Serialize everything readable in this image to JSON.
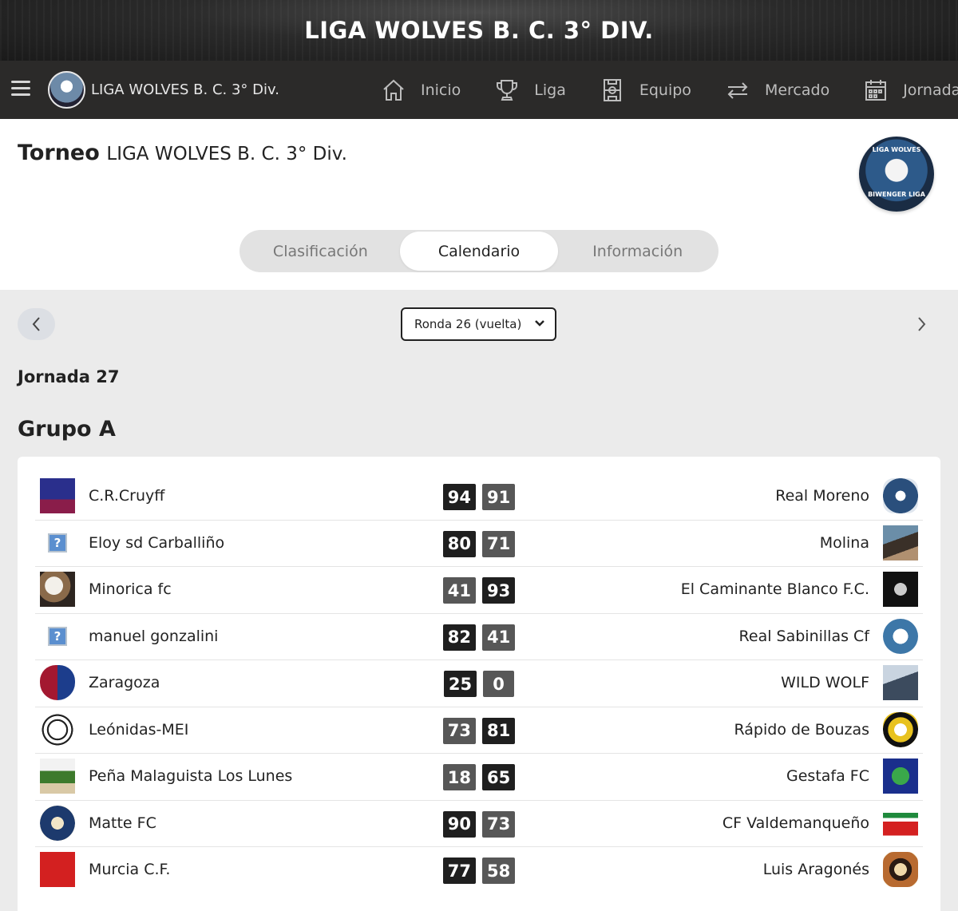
{
  "banner": {
    "title": "LIGA WOLVES B. C. 3° DIV."
  },
  "nav": {
    "league_name": "LIGA WOLVES B. C. 3° Div.",
    "items": [
      {
        "label": "Inicio",
        "icon": "home-icon"
      },
      {
        "label": "Liga",
        "icon": "trophy-icon"
      },
      {
        "label": "Equipo",
        "icon": "field-icon"
      },
      {
        "label": "Mercado",
        "icon": "transfer-icon"
      },
      {
        "label": "Jornada",
        "icon": "calendar-icon"
      }
    ]
  },
  "header": {
    "torneo_label": "Torneo",
    "torneo_name": "LIGA WOLVES B. C. 3° Div.",
    "badge_top": "LIGA WOLVES",
    "badge_bottom": "BIWENGER LIGA"
  },
  "tabs": [
    {
      "label": "Clasificación",
      "active": false
    },
    {
      "label": "Calendario",
      "active": true
    },
    {
      "label": "Información",
      "active": false
    }
  ],
  "round_selector": {
    "value": "Ronda 26 (vuelta)"
  },
  "jornada": {
    "title": "Jornada 27"
  },
  "group": {
    "title": "Grupo A"
  },
  "colors": {
    "score_winner": "#1f1f1f",
    "score_loser": "#575757",
    "nav_bg": "#2b2a29",
    "page_bg": "#ebebeb"
  },
  "matches": [
    {
      "home": "C.R.Cruyff",
      "home_score": "94",
      "away_score": "91",
      "away": "Real Moreno",
      "winner": "home"
    },
    {
      "home": "Eloy sd Carballiño",
      "home_score": "80",
      "away_score": "71",
      "away": "Molina",
      "winner": "home"
    },
    {
      "home": "Minorica fc",
      "home_score": "41",
      "away_score": "93",
      "away": "El Caminante Blanco F.C.",
      "winner": "away"
    },
    {
      "home": "manuel gonzalini",
      "home_score": "82",
      "away_score": "41",
      "away": "Real Sabinillas Cf",
      "winner": "home"
    },
    {
      "home": "Zaragoza",
      "home_score": "25",
      "away_score": "0",
      "away": "WILD WOLF",
      "winner": "home"
    },
    {
      "home": "Leónidas-MEI",
      "home_score": "73",
      "away_score": "81",
      "away": "Rápido de Bouzas",
      "winner": "away"
    },
    {
      "home": "Peña Malaguista Los Lunes",
      "home_score": "18",
      "away_score": "65",
      "away": "Gestafa FC",
      "winner": "away"
    },
    {
      "home": "Matte FC",
      "home_score": "90",
      "away_score": "73",
      "away": "CF Valdemanqueño",
      "winner": "home"
    },
    {
      "home": "Murcia C.F.",
      "home_score": "77",
      "away_score": "58",
      "away": "Luis Aragonés",
      "winner": "home"
    }
  ]
}
